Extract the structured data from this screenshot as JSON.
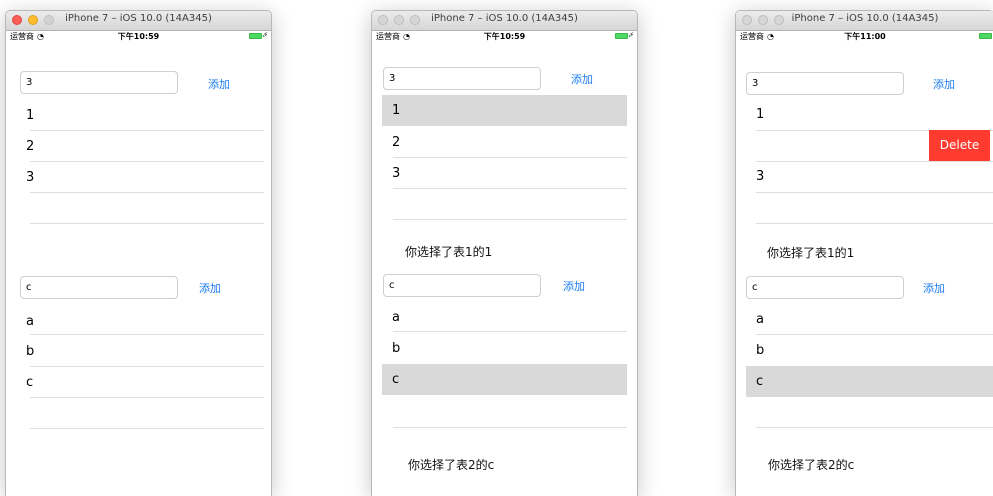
{
  "simulators": [
    {
      "window_title": "iPhone 7 – iOS 10.0 (14A345)",
      "carrier": "运营商",
      "time": "下午10:59",
      "table1": {
        "field_value": "3",
        "add_label": "添加",
        "rows": [
          "1",
          "2",
          "3"
        ]
      },
      "table2": {
        "field_value": "c",
        "add_label": "添加",
        "rows": [
          "a",
          "b",
          "c"
        ]
      }
    },
    {
      "window_title": "iPhone 7 – iOS 10.0 (14A345)",
      "carrier": "运营商",
      "time": "下午10:59",
      "table1": {
        "field_value": "3",
        "add_label": "添加",
        "rows": [
          "1",
          "2",
          "3"
        ],
        "selected": "1"
      },
      "message1": "你选择了表1的1",
      "table2": {
        "field_value": "c",
        "add_label": "添加",
        "rows": [
          "a",
          "b",
          "c"
        ],
        "selected": "c"
      },
      "message2": "你选择了表2的c"
    },
    {
      "window_title": "iPhone 7 – iOS 10.0 (14A345)",
      "carrier": "运营商",
      "time": "下午11:00",
      "table1": {
        "field_value": "3",
        "add_label": "添加",
        "rows": [
          "1",
          "",
          "3"
        ],
        "delete_label": "Delete"
      },
      "message1": "你选择了表1的1",
      "table2": {
        "field_value": "c",
        "add_label": "添加",
        "rows": [
          "a",
          "b",
          "c"
        ],
        "selected": "c"
      },
      "message2": "你选择了表2的c"
    }
  ],
  "colors": {
    "accent": "#1a7bf0",
    "delete": "#ff3b30",
    "selection": "#d9d9d9",
    "battery": "#4cd964"
  }
}
